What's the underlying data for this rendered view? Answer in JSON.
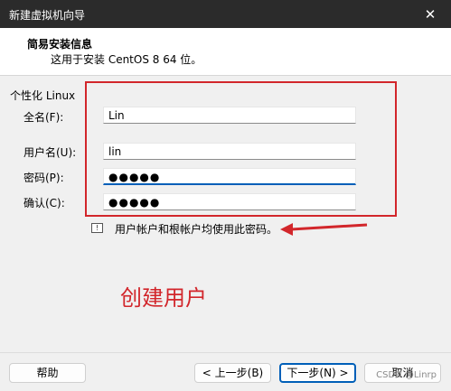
{
  "window": {
    "title": "新建虚拟机向导",
    "close_glyph": "✕"
  },
  "header": {
    "title": "简易安装信息",
    "subtitle": "这用于安装 CentOS 8 64 位。"
  },
  "section": {
    "label": "个性化 Linux"
  },
  "form": {
    "fullname_label": "全名(F):",
    "fullname_value": "Lin",
    "username_label": "用户名(U):",
    "username_value": "lin",
    "password_label": "密码(P):",
    "password_masked": "●●●●●",
    "confirm_label": "确认(C):",
    "confirm_masked": "●●●●●"
  },
  "hint": {
    "icon": "info-icon",
    "text": "用户帐户和根帐户均使用此密码。"
  },
  "annotation": {
    "text": "创建用户",
    "color": "#d2262b"
  },
  "buttons": {
    "help": "帮助",
    "back": "< 上一步(B)",
    "next": "下一步(N) >",
    "cancel": "取消"
  },
  "watermark": "CSDN @Linrp",
  "colors": {
    "accent": "#005fb8",
    "annotation_red": "#d2262b",
    "titlebar": "#2b2b2b"
  }
}
